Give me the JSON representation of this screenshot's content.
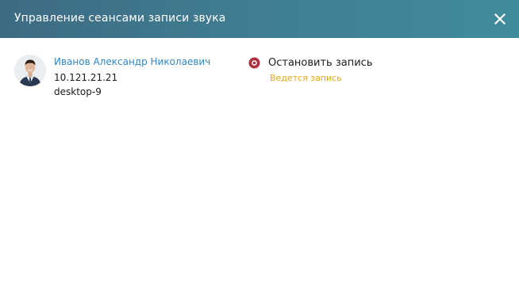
{
  "dialog": {
    "title": "Управление сеансами записи звука",
    "close_icon": "close-icon",
    "header_color": "#417e93"
  },
  "session": {
    "user_name": "Иванов Александр Николаевич",
    "ip": "10.121.21.21",
    "host": "desktop-9",
    "avatar": "user-avatar-photo",
    "action_label": "Остановить запись",
    "action_icon": "record-icon",
    "status": "Ведется запись",
    "colors": {
      "name_link": "#2e86c9",
      "record_icon": "#b0313f",
      "status": "#e5a91a"
    }
  }
}
